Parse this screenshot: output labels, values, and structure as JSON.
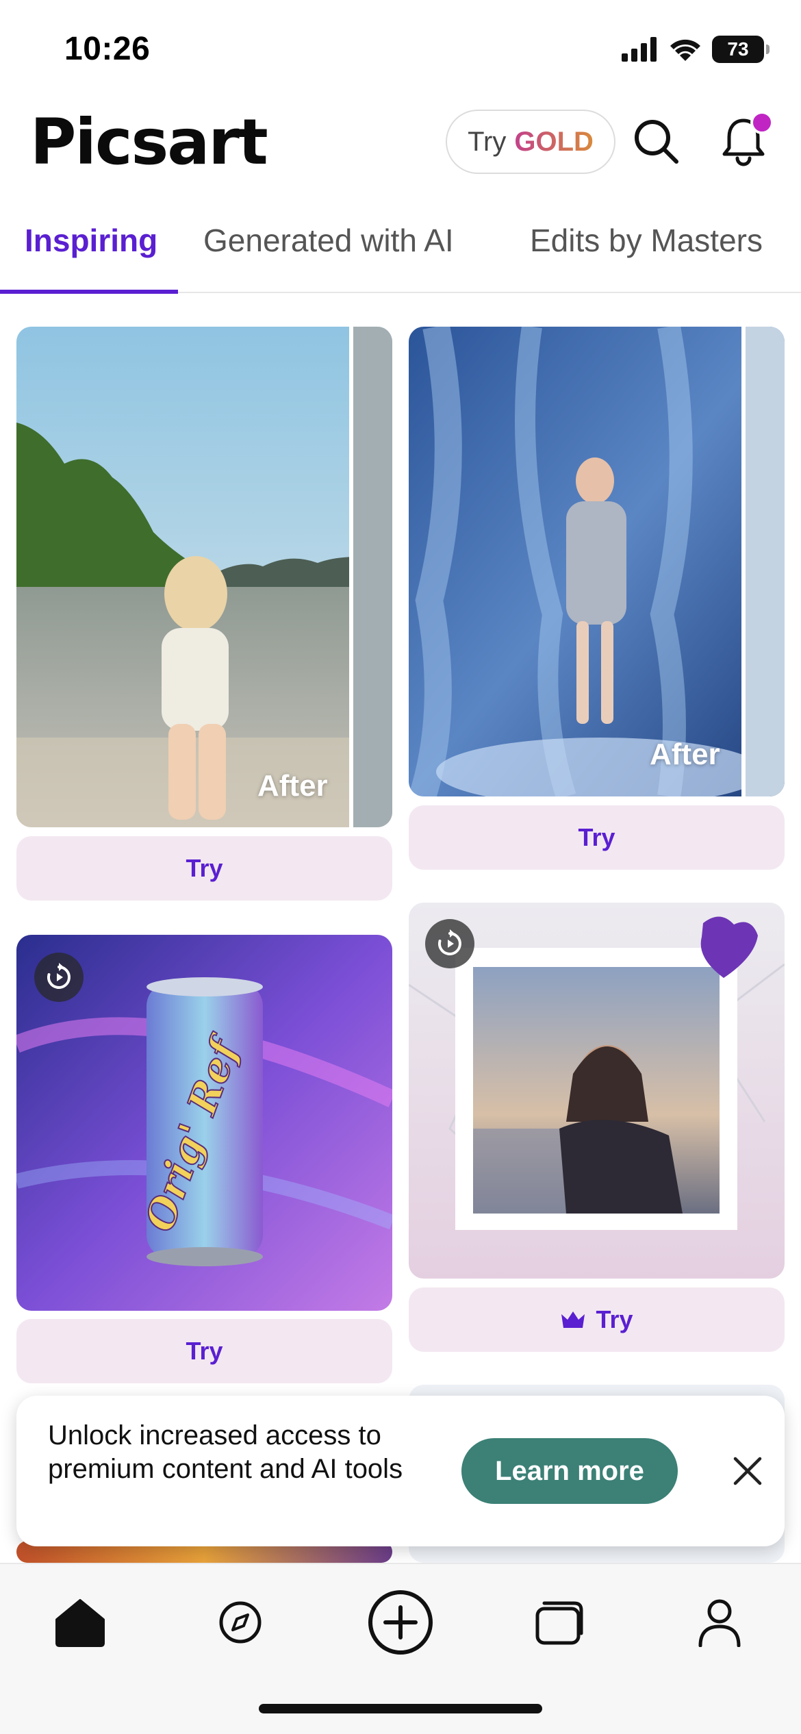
{
  "status_bar": {
    "time": "10:26",
    "battery": "73"
  },
  "header": {
    "logo": "Picsart",
    "try_gold": {
      "try": "Try",
      "gold": "GOLD"
    }
  },
  "tabs": [
    {
      "label": "Inspiring",
      "active": true
    },
    {
      "label": "Generated with AI",
      "active": false
    },
    {
      "label": "Edits by Masters",
      "active": false
    }
  ],
  "cards": [
    {
      "overlay": "After",
      "button": "Try",
      "premium": false
    },
    {
      "overlay": "After",
      "button": "Try",
      "premium": false
    },
    {
      "can_text": "Orig' Ref",
      "button": "Try",
      "premium": false
    },
    {
      "button": "Try",
      "premium": true
    }
  ],
  "banner": {
    "message": "Unlock increased access to premium content and AI tools",
    "cta": "Learn more"
  },
  "colors": {
    "accent": "#5a1fd1",
    "try_bg": "#f3e8f1",
    "learn_more_bg": "#3c8076",
    "notification_dot": "#c025c4"
  },
  "icons": [
    "signal-icon",
    "wifi-icon",
    "battery-icon",
    "search-icon",
    "bell-icon",
    "replay-icon",
    "crown-icon",
    "close-icon",
    "home-icon",
    "compass-icon",
    "plus-circle-icon",
    "folders-icon",
    "profile-icon"
  ]
}
